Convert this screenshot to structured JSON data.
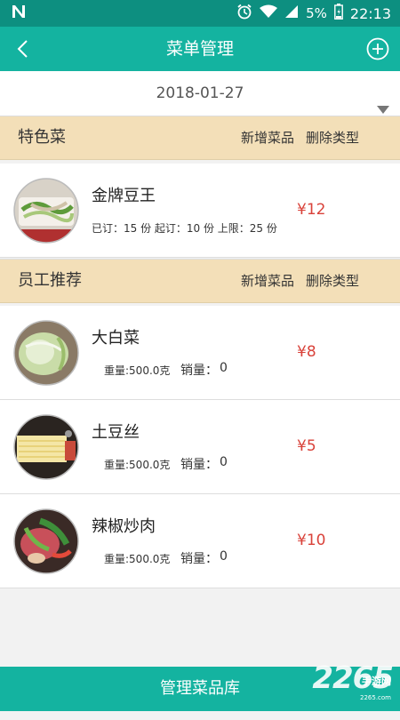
{
  "status_bar": {
    "battery": "5%",
    "time": "22:13"
  },
  "header": {
    "title": "菜单管理"
  },
  "date_filter": {
    "value": "2018-01-27"
  },
  "sections": [
    {
      "title": "特色菜",
      "add_label": "新增菜品",
      "delete_label": "删除类型",
      "dishes": [
        {
          "name": "金牌豆王",
          "info": "已订：15 份 起订：10 份 上限：25 份",
          "price": "¥12"
        }
      ]
    },
    {
      "title": "员工推荐",
      "add_label": "新增菜品",
      "delete_label": "删除类型",
      "dishes": [
        {
          "name": "大白菜",
          "weight": "重量:500.0克",
          "sales_label": "销量：",
          "sales": "0",
          "price": "¥8"
        },
        {
          "name": "土豆丝",
          "weight": "重量:500.0克",
          "sales_label": "销量：",
          "sales": "0",
          "price": "¥5"
        },
        {
          "name": "辣椒炒肉",
          "weight": "重量:500.0克",
          "sales_label": "销量：",
          "sales": "0",
          "price": "¥10"
        }
      ]
    }
  ],
  "footer": {
    "button_label": "管理菜品库"
  },
  "watermark": {
    "number": "2265",
    "text": "手游网",
    "url": "2265.com"
  },
  "colors": {
    "accent": "#14b3a0",
    "status_bar": "#0d8f80",
    "section_bg": "#f3dfb8",
    "price": "#d9423a"
  }
}
